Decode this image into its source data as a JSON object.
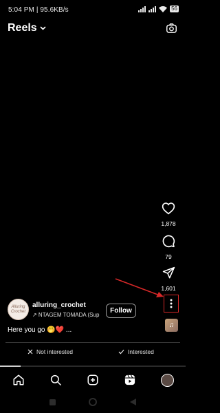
{
  "status_bar": {
    "time_speed": "5:04 PM | 95.6KB/s",
    "battery": "56"
  },
  "header": {
    "title": "Reels"
  },
  "rail": {
    "likes": "1,878",
    "comments": "79",
    "shares": "1,601"
  },
  "post": {
    "author": "alluring_crochet",
    "audio": "↗ NTAGEM TOMADA (Sup",
    "follow_label": "Follow",
    "caption": "Here you go 🤭❤️ ...",
    "avatar_text": "Alluring Crochet"
  },
  "feedback": {
    "not_interested": "Not interested",
    "interested": "Interested"
  },
  "progress": {
    "fraction": 0.11
  },
  "icons": {
    "camera": "camera-icon",
    "heart": "heart-icon",
    "comment": "comment-icon",
    "share": "paper-plane-icon",
    "more": "more-vertical-icon",
    "music": "music-icon",
    "home": "home-icon",
    "search": "search-icon",
    "create": "plus-square-icon",
    "reels": "reels-icon"
  },
  "colors": {
    "highlight": "#d62828",
    "background": "#000000"
  }
}
